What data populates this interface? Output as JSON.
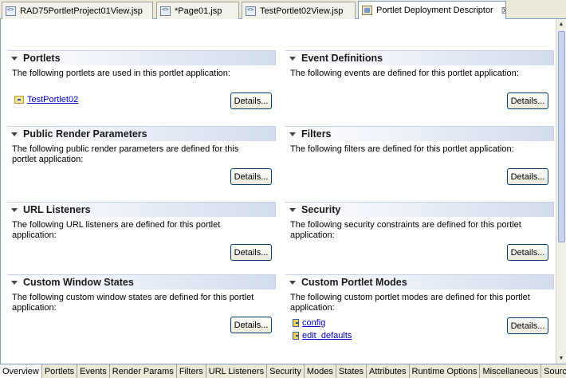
{
  "editor_tabs": [
    {
      "label": "RAD75PortletProject01View.jsp",
      "icon": "jsp-file-icon",
      "active": false
    },
    {
      "label": "*Page01.jsp",
      "icon": "jsp-file-icon",
      "active": false
    },
    {
      "label": "TestPortlet02View.jsp",
      "icon": "jsp-file-icon",
      "active": false
    },
    {
      "label": "Portlet Deployment Descriptor",
      "icon": "descriptor-icon",
      "active": true,
      "close": "☒"
    }
  ],
  "sections": {
    "portlets": {
      "title": "Portlets",
      "description": "The following portlets are used in this portlet application:",
      "items": [
        "TestPortlet02"
      ]
    },
    "event_definitions": {
      "title": "Event Definitions",
      "description": "The following events are defined for this portlet application:"
    },
    "public_render_parameters": {
      "title": "Public Render Parameters",
      "description": "The following public render parameters are defined for this portlet application:"
    },
    "filters": {
      "title": "Filters",
      "description": "The following filters are defined for this portlet application:"
    },
    "url_listeners": {
      "title": "URL Listeners",
      "description": "The following URL listeners are defined for this portlet application:"
    },
    "security": {
      "title": "Security",
      "description": "The following security constraints are defined for this portlet application:"
    },
    "custom_window_states": {
      "title": "Custom Window States",
      "description": "The following custom window states are defined for this portlet application:"
    },
    "custom_portlet_modes": {
      "title": "Custom Portlet Modes",
      "description": "The following custom portlet modes are defined for this portlet application:",
      "items": [
        "config",
        "edit_defaults"
      ]
    }
  },
  "details_label": "Details...",
  "bottom_tabs": [
    "Overview",
    "Portlets",
    "Events",
    "Render Params",
    "Filters",
    "URL Listeners",
    "Security",
    "Modes",
    "States",
    "Attributes",
    "Runtime Options",
    "Miscellaneous",
    "Source"
  ],
  "active_bottom_tab": "Overview",
  "colors": {
    "link": "#0000cc",
    "tab_bar": "#ece9d8",
    "header_gradient_end": "#d3dced"
  }
}
